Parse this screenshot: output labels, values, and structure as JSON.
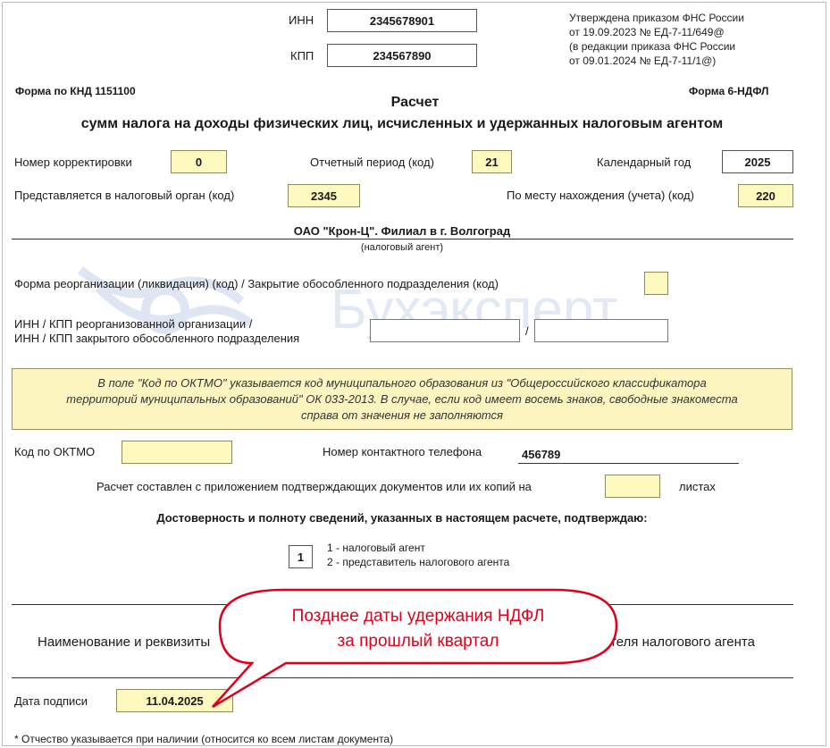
{
  "header": {
    "inn_label": "ИНН",
    "inn_value": "2345678901",
    "kpp_label": "КПП",
    "kpp_value": "234567890",
    "approval_lines": [
      "Утверждена приказом ФНС России",
      "от 19.09.2023 № ЕД-7-11/649@",
      "(в редакции приказа ФНС России",
      "от 09.01.2024 № ЕД-7-11/1@)"
    ],
    "knd_form": "Форма по КНД 1151100",
    "form_name": "Форма 6-НДФЛ",
    "title_line1": "Расчет",
    "title_line2": "сумм налога на доходы физических лиц, исчисленных и удержанных налоговым агентом"
  },
  "fields": {
    "correction_label": "Номер корректировки",
    "correction_value": "0",
    "period_label": "Отчетный период (код)",
    "period_value": "21",
    "year_label": "Календарный год",
    "year_value": "2025",
    "tax_office_label": "Представляется в налоговый орган (код)",
    "tax_office_value": "2345",
    "location_label": "По месту нахождения (учета) (код)",
    "location_value": "220"
  },
  "agent": {
    "name": "ОАО \"Крон-Ц\". Филиал в г. Волгоград",
    "caption": "(налоговый агент)"
  },
  "reorg": {
    "form_label": "Форма реорганизации (ликвидация) (код) / Закрытие обособленного подразделения (код)",
    "inn_kpp_label_line1": "ИНН / КПП реорганизованной организации /",
    "inn_kpp_label_line2": "ИНН / КПП закрытого обособленного подразделения",
    "separator": "/"
  },
  "oktmo_note": {
    "line1": "В поле \"Код по ОКТМО\" указывается код муниципального образования из \"Общероссийского классификатора",
    "line2": "территорий муниципальных образований\" ОК 033-2013. В случае, если код имеет восемь знаков, свободные знакоместа",
    "line3": "справа от значения не заполняются"
  },
  "contact": {
    "oktmo_label": "Код по ОКТМО",
    "phone_label": "Номер контактного телефона",
    "phone_value": "456789",
    "attachments_label": "Расчет составлен с приложением подтверждающих документов или их копий на",
    "sheets_label": "листах"
  },
  "confirm": {
    "heading": "Достоверность и полноту сведений, указанных в настоящем расчете, подтверждаю:",
    "code_value": "1",
    "option1": "1 - налоговый агент",
    "option2": "2 - представитель налогового агента"
  },
  "representative": {
    "label_left": "Наименование и реквизиты",
    "label_right": "теля налогового агента"
  },
  "signature": {
    "date_label": "Дата подписи",
    "date_value": "11.04.2025"
  },
  "footnote": "* Отчество указывается при наличии (относится ко всем листам документа)",
  "callout": {
    "line1": "Позднее даты удержания НДФЛ",
    "line2": "за прошлый квартал",
    "color": "#e0001b"
  },
  "watermark": {
    "text": "Бухэксперт"
  }
}
